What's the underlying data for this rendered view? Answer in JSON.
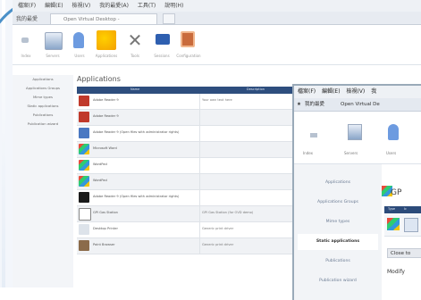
{
  "back_window": {
    "menu": [
      "檔案(F)",
      "編輯(E)",
      "檢視(V)",
      "我的最愛(A)",
      "工具(T)",
      "說明(H)"
    ],
    "favorites_label": "我的最愛",
    "tab_title": "Open Virtual Desktop - administration",
    "toolbar": [
      {
        "label": "Index",
        "icon": "home-icon"
      },
      {
        "label": "Servers",
        "icon": "server-icon"
      },
      {
        "label": "Users",
        "icon": "users-icon"
      },
      {
        "label": "Applications",
        "icon": "applications-icon"
      },
      {
        "label": "Tools",
        "icon": "tools-icon"
      },
      {
        "label": "Sessions",
        "icon": "sessions-icon"
      },
      {
        "label": "Configuration",
        "icon": "configuration-icon"
      }
    ],
    "sidebar": [
      "Applications",
      "Applications Groups",
      "Mime types",
      "Static applications",
      "Publications",
      "Publication wizard"
    ],
    "section_title": "Applications",
    "table_headers": [
      "Name",
      "Description"
    ],
    "rows": [
      {
        "name": "Adobe Reader 9",
        "desc": "Your own text here"
      },
      {
        "name": "Adobe Reader 9",
        "desc": ""
      },
      {
        "name": "Adobe Reader 9 (Open files with administrator rights)",
        "desc": ""
      },
      {
        "name": "Microsoft Word",
        "desc": ""
      },
      {
        "name": "WordPad",
        "desc": ""
      },
      {
        "name": "WordPad",
        "desc": ""
      },
      {
        "name": "Adobe Reader 9 (Open files with administrator rights)",
        "desc": ""
      },
      {
        "name": "GPI Gas Station",
        "desc": "GPI Gas Station (for OVD demo)"
      },
      {
        "name": "Desktop Printer",
        "desc": "Generic print driver"
      },
      {
        "name": "Paint Browser",
        "desc": "Generic print driver"
      }
    ],
    "colors": {
      "header": "#2e4e7e",
      "accent": "#d7e3f3"
    }
  },
  "front_window": {
    "menu": [
      "檔案(F)",
      "編輯(E)",
      "檢視(V)",
      "我"
    ],
    "favorites_label": "我的最愛",
    "tab_title": "Open Virtual De",
    "toolbar": [
      {
        "label": "Index",
        "icon": "home-icon"
      },
      {
        "label": "Servers",
        "icon": "server-icon"
      },
      {
        "label": "Users",
        "icon": "users-icon"
      }
    ],
    "sidebar": [
      "Applications",
      "Applications Groups",
      "Mime types",
      "Static applications",
      "Publications",
      "Publication wizard"
    ],
    "active_sidebar": "Static applications",
    "app_title": "GP",
    "mini_table_headers": [
      "Type",
      "Ic"
    ],
    "close_button": "Close to",
    "modify_label": "Modify"
  }
}
